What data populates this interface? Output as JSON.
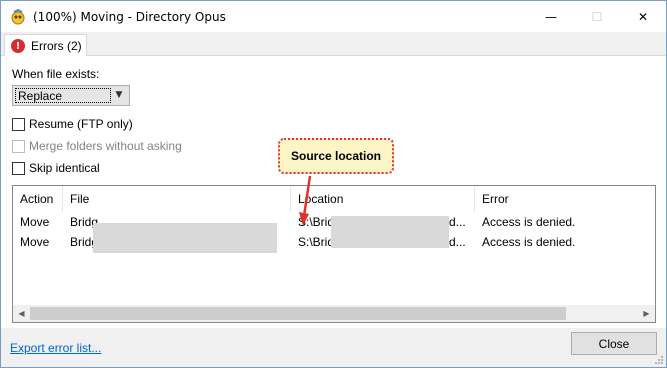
{
  "window": {
    "title": "(100%) Moving - Directory Opus",
    "minimize": "—",
    "maximize": "☐",
    "close": "✕"
  },
  "tab": {
    "icon_glyph": "!",
    "label": "Errors (2)"
  },
  "options": {
    "when_exists_label": "When file exists:",
    "when_exists_value": "Replace",
    "resume_label": "Resume (FTP only)",
    "merge_label": "Merge folders without asking",
    "skip_label": "Skip identical"
  },
  "callout": {
    "text": "Source location"
  },
  "error_list": {
    "columns": [
      "Action",
      "File",
      "Location",
      "Error"
    ],
    "rows": [
      {
        "action": "Move",
        "file": "Bridg",
        "location": "S:\\Brid",
        "location_tail": "d...",
        "error": "Access is denied."
      },
      {
        "action": "Move",
        "file": "Bridg",
        "location": "S:\\Brid",
        "location_tail": "d...",
        "error": "Access is denied."
      }
    ],
    "scroll_left": "◀",
    "scroll_right": "▶"
  },
  "footer": {
    "export_link": "Export error list...",
    "close_label": "Close"
  },
  "colors": {
    "accent_link": "#0066cc",
    "callout_border": "#e0332e",
    "callout_fill": "#fdf5c8",
    "error_icon": "#d92b2b"
  }
}
